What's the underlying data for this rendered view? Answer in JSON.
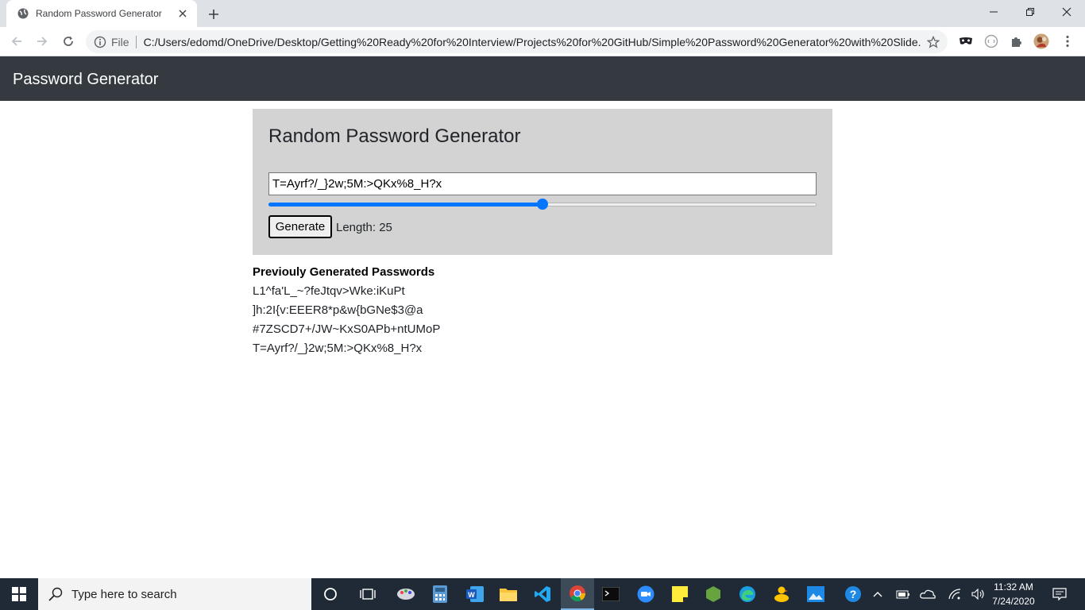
{
  "browser": {
    "tab_title": "Random Password Generator",
    "file_label": "File",
    "url": "C:/Users/edomd/OneDrive/Desktop/Getting%20Ready%20for%20Interview/Projects%20for%20GitHub/Simple%20Password%20Generator%20with%20Slide..."
  },
  "navbar": {
    "brand": "Password Generator"
  },
  "generator": {
    "heading": "Random Password Generator",
    "password": "T=Ayrf?/_}2w;5M:>QKx%8_H?x",
    "slider_fraction": 0.5,
    "button_label": "Generate",
    "length_label": "Length: 25"
  },
  "history": {
    "title": "Previouly Generated Passwords",
    "items": [
      "L1^fa'L_~?feJtqv>Wke:iKuPt",
      "]h:2I{v:EEER8*p&w{bGNe$3@a",
      "#7ZSCD7+/JW~KxS0APb+ntUMoP",
      "T=Ayrf?/_}2w;5M:>QKx%8_H?x"
    ]
  },
  "taskbar": {
    "search_placeholder": "Type here to search",
    "time": "11:32 AM",
    "date": "7/24/2020"
  },
  "colors": {
    "navbar": "#343a40",
    "card": "#d3d3d3",
    "accent": "#0075ff",
    "taskbar": "#1f2a36"
  }
}
